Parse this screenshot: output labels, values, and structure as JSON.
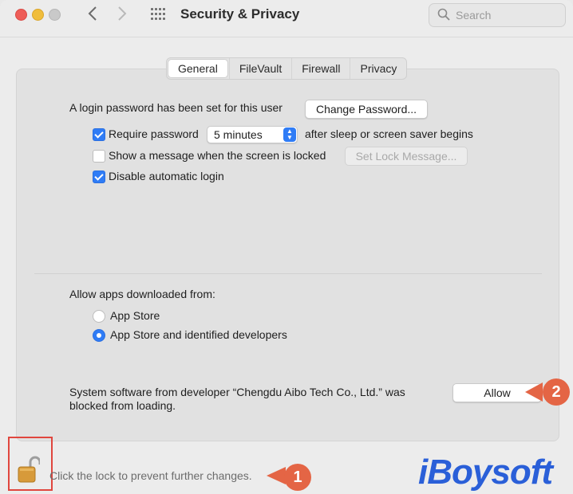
{
  "window": {
    "title": "Security & Privacy"
  },
  "search": {
    "placeholder": "Search"
  },
  "tabs": [
    {
      "label": "General",
      "active": true
    },
    {
      "label": "FileVault"
    },
    {
      "label": "Firewall"
    },
    {
      "label": "Privacy"
    }
  ],
  "general": {
    "login_text": "A login password has been set for this user",
    "change_password_label": "Change Password...",
    "require_password": {
      "checked": true,
      "label": "Require password",
      "delay": "5 minutes",
      "suffix": "after sleep or screen saver begins"
    },
    "show_message": {
      "checked": false,
      "label": "Show a message when the screen is locked",
      "button_label": "Set Lock Message..."
    },
    "disable_auto_login": {
      "checked": true,
      "label": "Disable automatic login"
    }
  },
  "apps": {
    "heading": "Allow apps downloaded from:",
    "options": [
      {
        "label": "App Store",
        "selected": false
      },
      {
        "label": "App Store and identified developers",
        "selected": true
      }
    ]
  },
  "blocked": {
    "line1": "System software from developer “Chengdu Aibo Tech Co., Ltd.” was",
    "line2": "blocked from loading.",
    "allow_label": "Allow"
  },
  "footer": {
    "lock_text": "Click the lock to prevent further changes."
  },
  "annotations": {
    "callout_1": "1",
    "callout_2": "2",
    "callout_color": "#e46545",
    "highlight_color": "#e0463e"
  },
  "watermark": {
    "text": "iBoysoft",
    "color": "#2a5fd8"
  },
  "icons": {
    "back": "chevron-left-icon",
    "forward": "chevron-right-icon",
    "grid": "grid-icon",
    "search": "search-icon",
    "lock": "lock-open-icon"
  }
}
